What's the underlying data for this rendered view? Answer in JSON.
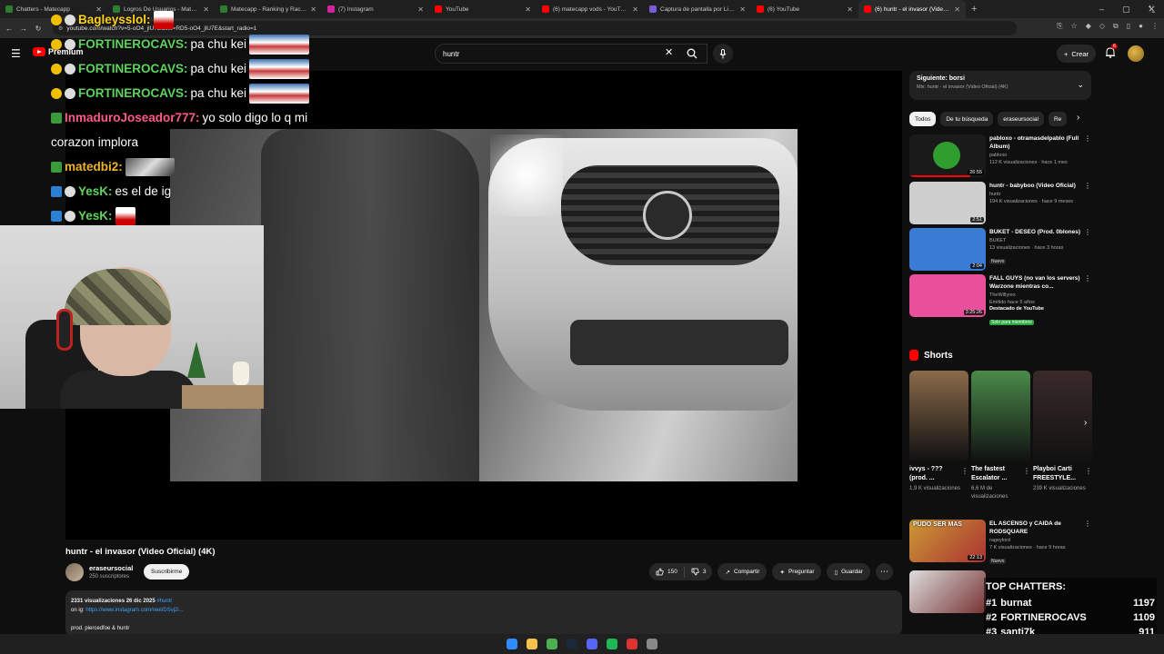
{
  "browser": {
    "tabs": [
      {
        "label": "Chatters - Matecapp",
        "color": "#2e7d32"
      },
      {
        "label": "Logros De Usuarios - Matecapp",
        "color": "#2e7d32"
      },
      {
        "label": "Matecapp - Ranking y Racha de...",
        "color": "#2e7d32"
      },
      {
        "label": "(7) Instagram",
        "color": "#d6249f"
      },
      {
        "label": "YouTube",
        "color": "#ff0000"
      },
      {
        "label": "(6) matecapp vods - YouTube",
        "color": "#ff0000"
      },
      {
        "label": "Captura de pantalla por Lightsh...",
        "color": "#7b5cd6"
      },
      {
        "label": "(6) YouTube",
        "color": "#ff0000"
      },
      {
        "label": "(6) huntr - el invasor (Video Of...",
        "color": "#ff0000",
        "active": true
      }
    ],
    "url": "youtube.com/watch?v=5-oO4_jlU7E&list=RD5-oO4_jlU7E&start_radio=1"
  },
  "header": {
    "logo_label": "Premium",
    "search_value": "huntr",
    "create_label": "Crear",
    "notif_count": "6"
  },
  "chat": {
    "messages": [
      {
        "user": "Bagleysslol:",
        "color": "#ffd21e",
        "text": "",
        "badge": "y",
        "emote": "xs"
      },
      {
        "user": "FORTINEROCAVS:",
        "color": "#5ed35e",
        "text": "pa chu kei",
        "badge": "y",
        "emote": "lg"
      },
      {
        "user": "FORTINEROCAVS:",
        "color": "#5ed35e",
        "text": "pa chu kei",
        "badge": "y",
        "emote": "lg"
      },
      {
        "user": "FORTINEROCAVS:",
        "color": "#5ed35e",
        "text": "pa chu kei",
        "badge": "y",
        "emote": "lg"
      },
      {
        "user": "InmaduroJoseador777:",
        "color": "#ff5b87",
        "text": "yo solo digo lo q mi",
        "badge": "g",
        "emote": ""
      },
      {
        "user": "",
        "color": "#ffffff",
        "text": "corazon implora",
        "badge": "",
        "emote": ""
      },
      {
        "user": "matedbi2:",
        "color": "#f0b429",
        "text": "",
        "badge": "g",
        "emote": "sm"
      },
      {
        "user": "YesK:",
        "color": "#5ed35e",
        "text": "es el de ig",
        "badge": "b",
        "emote": ""
      },
      {
        "user": "YesK:",
        "color": "#5ed35e",
        "text": "",
        "badge": "b",
        "emote": "xs"
      }
    ]
  },
  "video": {
    "title": "huntr - el invasor (Video Oficial) (4K)",
    "channel": "eraseursocial",
    "subs": "250 suscriptores",
    "subscribe_label": "Suscribirme",
    "likes": "150",
    "dislikes": "3",
    "share_label": "Compartir",
    "ask_label": "Preguntar",
    "save_label": "Guardar",
    "desc_stats": "2331 visualizaciones  26 dic 2025",
    "desc_tag": "#huntr",
    "desc_ig_prefix": "on ig:",
    "desc_ig_link": "https://www.instagram.com/reel/DSvj2i...",
    "desc_credit": "prod. piercedfoe & huntr"
  },
  "sidebar": {
    "next_title": "Siguiente: borsi",
    "next_sub": "Mix: huntr - el invasor (Video Oficial) (4K)",
    "chips": [
      "Todos",
      "De tu búsqueda",
      "eraseursocial",
      "Re"
    ],
    "recs": [
      {
        "title": "pabloxo - otramasdelpablo (Full Album)",
        "channel": "pabloxo",
        "views": "112 K visualizaciones · hace 1 mes",
        "dur": "26:55",
        "thumb": "#1a1a1a",
        "badge": "",
        "progress": 0.8
      },
      {
        "title": "huntr - babyboo (Video Oficial)",
        "channel": "huntr",
        "views": "194 K visualizaciones · hace 9 meses",
        "dur": "2:51",
        "thumb": "#cfcfcf",
        "badge": "",
        "progress": 0
      },
      {
        "title": "BUKET - DESEO (Prod. 0blones)",
        "channel": "BUKET",
        "views": "13 visualizaciones · hace 3 horas",
        "dur": "2:04",
        "thumb": "#3a7bd5",
        "badge": "Nuevo",
        "progress": 0
      },
      {
        "title": "FALL GUYS (no van los servers) Warzone mientras co...",
        "channel": "TheWillyrex",
        "views": "Emitido hace 5 años",
        "dur": "3:25:26",
        "thumb": "#e94f9b",
        "badge": "Destacado de YouTube",
        "extra": "Solo para miembros",
        "progress": 0
      }
    ],
    "shorts_label": "Shorts",
    "shorts": [
      {
        "title": "ivvys - ??? (prod. ...",
        "views": "1,9 K visualizaciones",
        "thumb": "#8a6a4a"
      },
      {
        "title": "The fastest Escalator ...",
        "views": "6,6 M de visualizaciones",
        "thumb": "#4a8a4a"
      },
      {
        "title": "Playboi Carti FREESTYLE...",
        "views": "239 K visualizaciones",
        "thumb": "#3a2a2a"
      }
    ],
    "rec5": {
      "title": "EL ASCENSO y CAIDA de RODSQUARE",
      "channel": "rageylord",
      "views": "7 K visualizaciones · hace 9 horas",
      "dur": "22:13",
      "badge": "Nuevo",
      "thumb_text": "PUDO SER MAS"
    }
  },
  "top_chatters": {
    "title": "TOP CHATTERS:",
    "rows": [
      {
        "rank": "#1",
        "name": "burnat",
        "count": "1197"
      },
      {
        "rank": "#2",
        "name": "FORTINEROCAVS",
        "count": "1109"
      },
      {
        "rank": "#3",
        "name": "santi7k",
        "count": "911"
      }
    ]
  },
  "taskbar": {
    "icons": [
      "windows-icon",
      "explorer-icon",
      "chrome-icon",
      "steam-icon",
      "discord-icon",
      "spotify-icon",
      "app-icon",
      "terminal-icon"
    ],
    "colors": [
      "#2f8cff",
      "#f2c24a",
      "#4caf50",
      "#1b2838",
      "#5865f2",
      "#1db954",
      "#d33",
      "#888"
    ]
  }
}
